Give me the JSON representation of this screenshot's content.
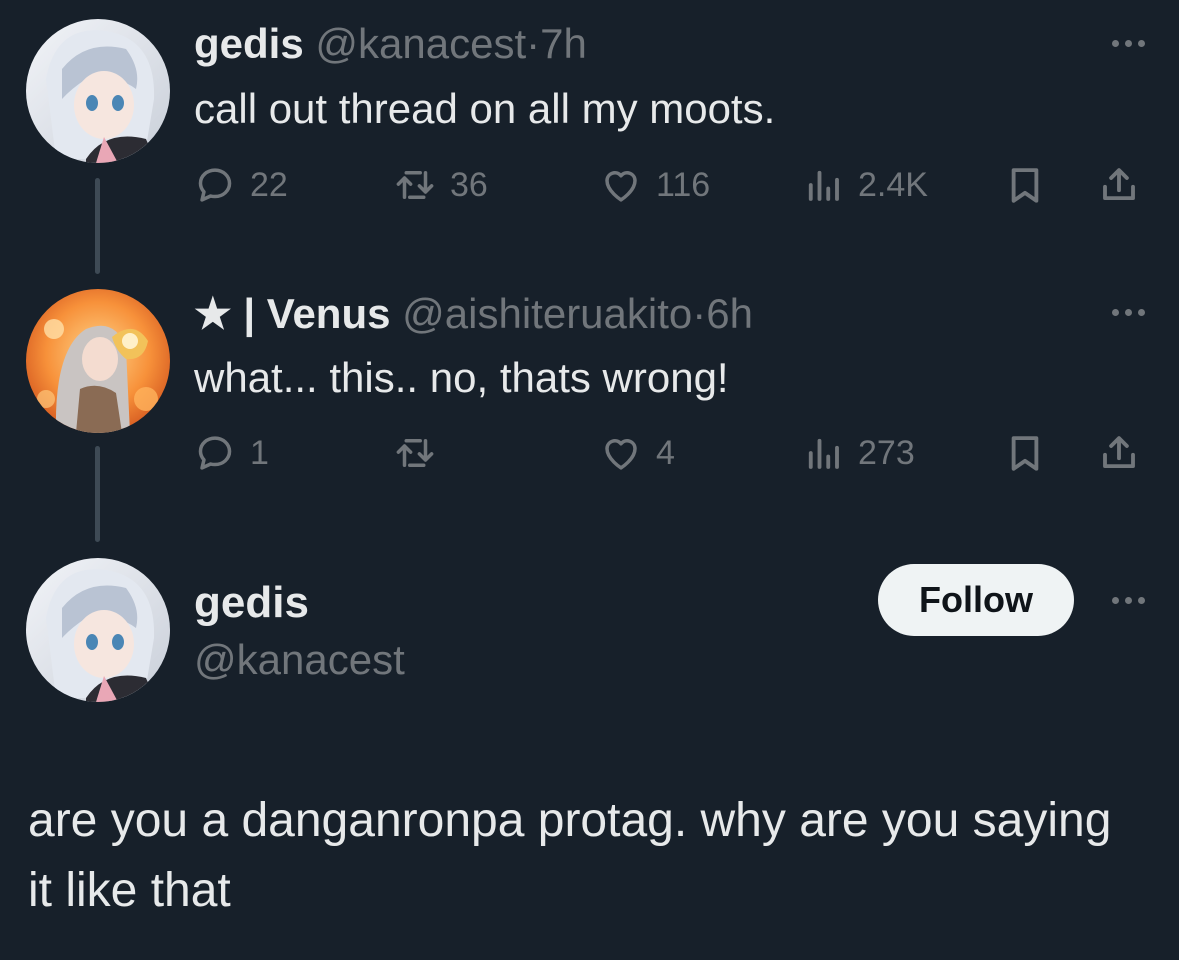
{
  "tweet1": {
    "name": "gedis",
    "handle": "@kanacest",
    "separator": "·",
    "time": "7h",
    "text": "call out thread on all my moots.",
    "replies": "22",
    "reposts": "36",
    "likes": "116",
    "views": "2.4K"
  },
  "tweet2": {
    "name_prefix": "★ | ",
    "name": "Venus",
    "handle": "@aishiteruakito",
    "separator": "·",
    "time": "6h",
    "text": "what... this.. no, thats wrong!",
    "replies": "1",
    "reposts": "",
    "likes": "4",
    "views": "273"
  },
  "main_tweet": {
    "name": "gedis",
    "handle": "@kanacest",
    "follow_label": "Follow",
    "text": "are you a danganronpa protag. why are you saying it like that"
  },
  "icons": {
    "reply": "reply-icon",
    "repost": "repost-icon",
    "like": "heart-icon",
    "views": "views-icon",
    "bookmark": "bookmark-icon",
    "share": "share-icon",
    "more": "more-icon"
  },
  "colors": {
    "background": "#17202a",
    "text": "#e7e9ea",
    "muted": "#71767b",
    "button_bg": "#eff3f4"
  }
}
